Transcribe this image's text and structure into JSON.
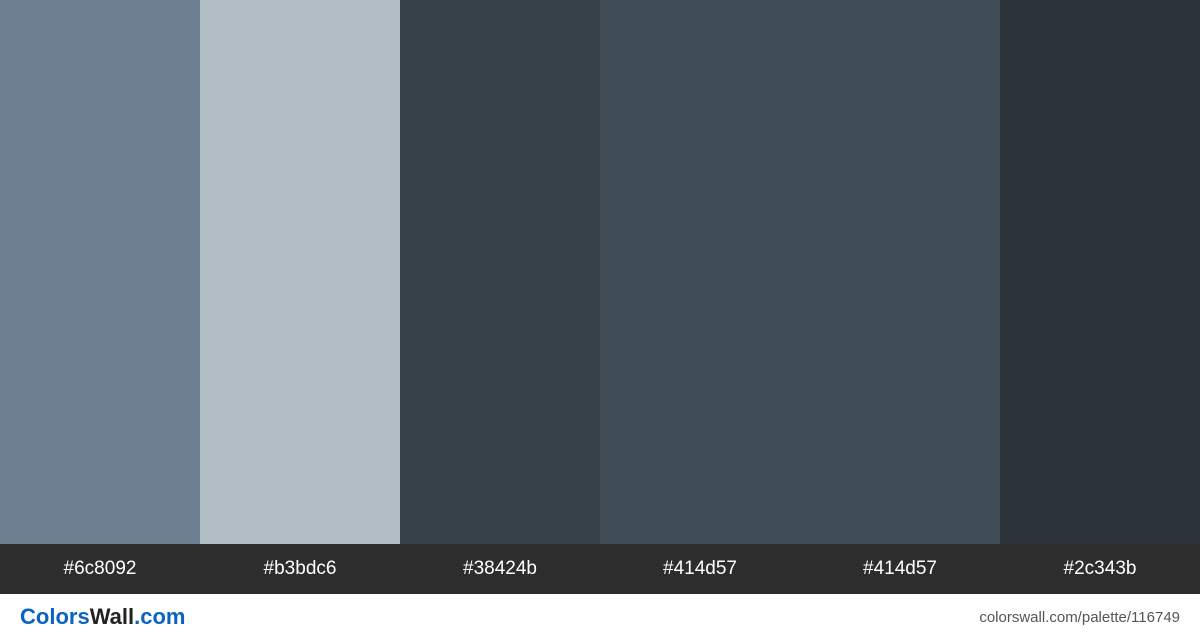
{
  "swatches": [
    {
      "hex": "#6c8092"
    },
    {
      "hex": "#b3bdc6"
    },
    {
      "hex": "#38424b"
    },
    {
      "hex": "#414d57"
    },
    {
      "hex": "#414d57"
    },
    {
      "hex": "#2c343b"
    }
  ],
  "brand": {
    "part1": "Colors",
    "part2": "Wall",
    "part3": ".com"
  },
  "permalink": "colorswall.com/palette/116749"
}
